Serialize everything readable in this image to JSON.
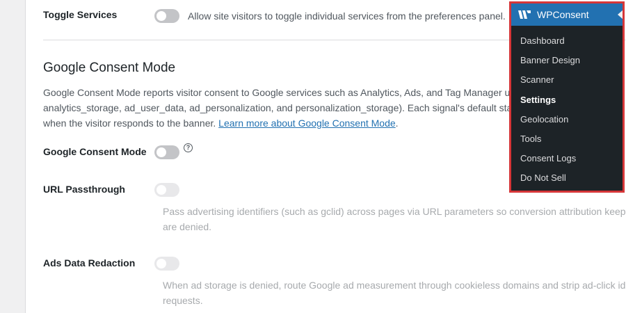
{
  "toggle_services": {
    "label": "Toggle Services",
    "description": "Allow site visitors to toggle individual services from the preferences panel."
  },
  "gcm_section": {
    "title": "Google Consent Mode",
    "line1": "Google Consent Mode reports visitor consent to Google services such as Analytics, Ads, and Tag Manager usi",
    "line2": "analytics_storage, ad_user_data, ad_personalization, and personalization_storage). Each signal's default state f",
    "line3_prefix": "when the visitor responds to the banner. ",
    "link": "Learn more about Google Consent Mode",
    "line3_suffix": "."
  },
  "gcm_row": {
    "label": "Google Consent Mode",
    "help": "?"
  },
  "url_passthrough": {
    "label": "URL Passthrough",
    "line1": "Pass advertising identifiers (such as gclid) across pages via URL parameters so conversion attribution keeps w",
    "line2": "are denied."
  },
  "ads_redaction": {
    "label": "Ads Data Redaction",
    "line1": "When ad storage is denied, route Google ad measurement through cookieless domains and strip ad-click ide",
    "line2": "requests."
  },
  "menu": {
    "brand": "WPConsent",
    "items": [
      {
        "label": "Dashboard"
      },
      {
        "label": "Banner Design"
      },
      {
        "label": "Scanner"
      },
      {
        "label": "Settings"
      },
      {
        "label": "Geolocation"
      },
      {
        "label": "Tools"
      },
      {
        "label": "Consent Logs"
      },
      {
        "label": "Do Not Sell"
      }
    ]
  },
  "colors": {
    "menu_bg": "#1d2327",
    "menu_header": "#2271b1",
    "highlight_border": "#d63638",
    "link": "#2271b1"
  }
}
